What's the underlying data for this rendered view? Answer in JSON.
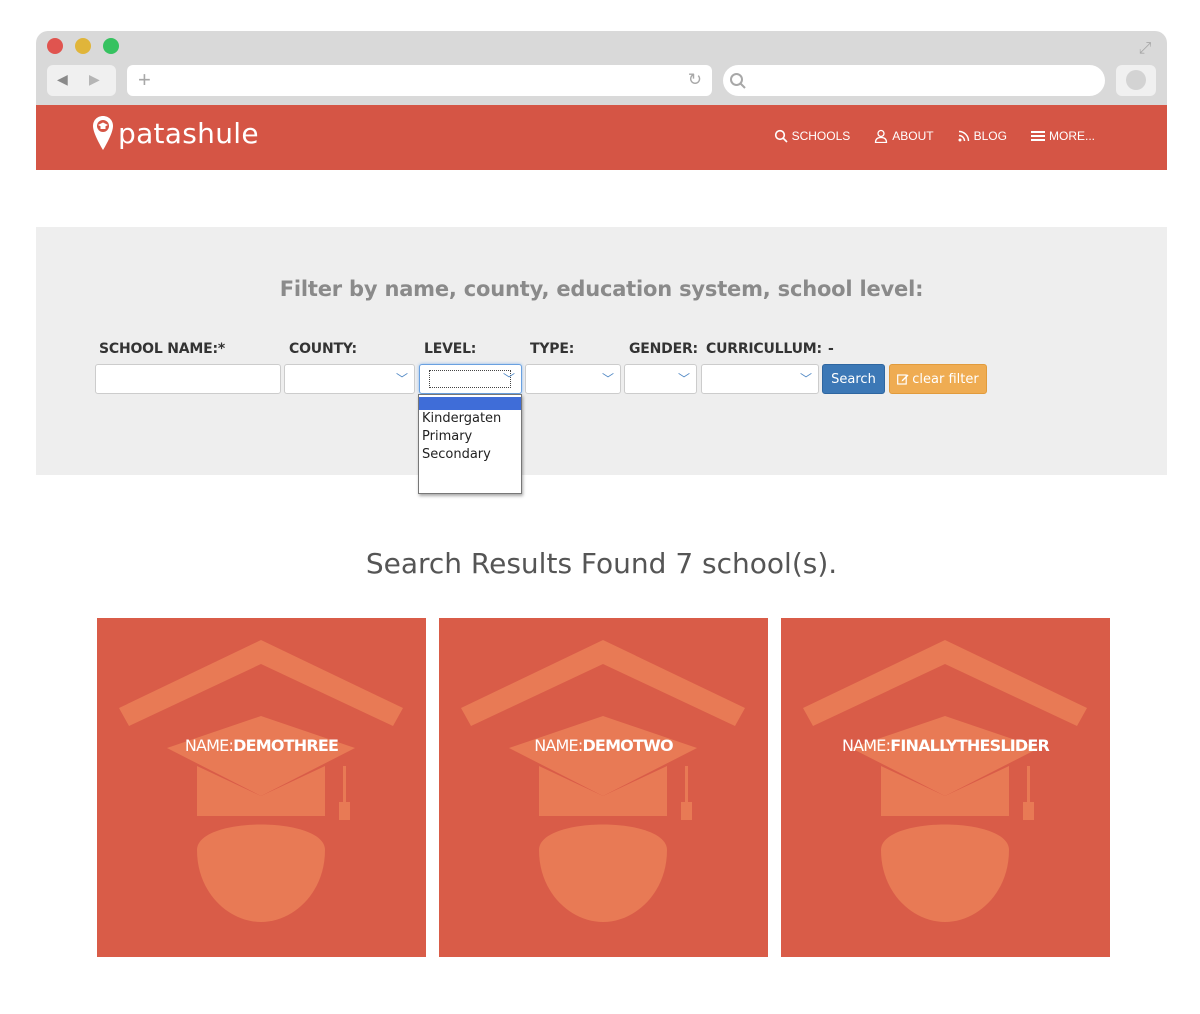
{
  "browser": {
    "url": "",
    "search_placeholder": ""
  },
  "header": {
    "brand": "patashule",
    "nav": [
      {
        "label": "SCHOOLS",
        "icon": "search-icon"
      },
      {
        "label": "ABOUT",
        "icon": "user-icon"
      },
      {
        "label": "BLOG",
        "icon": "rss-icon"
      },
      {
        "label": "MORE...",
        "icon": "menu-icon"
      }
    ]
  },
  "filter": {
    "title": "Filter by name, county, education system, school level:",
    "labels": {
      "school_name": "SCHOOL NAME:*",
      "county": "COUNTY:",
      "level": "LEVEL:",
      "type": "TYPE:",
      "gender": "GENDER:",
      "curriculum": "CURRICULLUM:",
      "dash": "-"
    },
    "school_name_value": "",
    "level_options": [
      "",
      "Kindergaten",
      "Primary",
      "Secondary"
    ],
    "search_label": "Search",
    "clear_label": "clear filter"
  },
  "results": {
    "title": "Search Results Found 7 school(s).",
    "name_prefix": "NAME:",
    "cards": [
      {
        "name": "DEMOTHREE"
      },
      {
        "name": "DEMOTWO"
      },
      {
        "name": "FINALLYTHESLIDER"
      }
    ]
  },
  "colors": {
    "brand": "#d55545",
    "card": "#d95c48",
    "card_art": "#e87a55",
    "search_button": "#3c78b6",
    "clear_button": "#efac52",
    "filter_bg": "#eeeeee"
  }
}
